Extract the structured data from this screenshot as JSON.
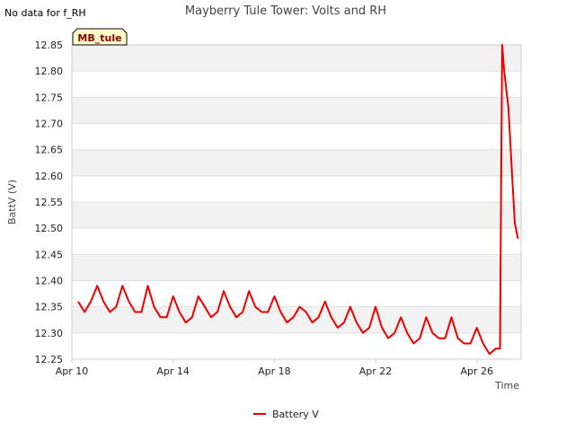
{
  "notice": "No data for f_RH",
  "badge": "MB_tule",
  "chart_data": {
    "type": "line",
    "title": "Mayberry Tule Tower: Volts and RH",
    "xlabel": "Time",
    "ylabel": "BattV (V)",
    "ylim": [
      12.25,
      12.85
    ],
    "xlim": [
      "2023-04-10",
      "2023-04-27T18:00"
    ],
    "x_ticks": [
      "Apr 10",
      "Apr 14",
      "Apr 18",
      "Apr 22",
      "Apr 26"
    ],
    "y_ticks": [
      "12.25",
      "12.30",
      "12.35",
      "12.40",
      "12.45",
      "12.50",
      "12.55",
      "12.60",
      "12.65",
      "12.70",
      "12.75",
      "12.80",
      "12.85"
    ],
    "grid": true,
    "legend": "bottom-center",
    "series": [
      {
        "name": "Battery V",
        "color": "#ee0000",
        "x": [
          "2023-04-10T06:00",
          "2023-04-10T12:00",
          "2023-04-10T18:00",
          "2023-04-11T00:00",
          "2023-04-11T06:00",
          "2023-04-11T12:00",
          "2023-04-11T18:00",
          "2023-04-12T00:00",
          "2023-04-12T06:00",
          "2023-04-12T12:00",
          "2023-04-12T18:00",
          "2023-04-13T00:00",
          "2023-04-13T06:00",
          "2023-04-13T12:00",
          "2023-04-13T18:00",
          "2023-04-14T00:00",
          "2023-04-14T06:00",
          "2023-04-14T12:00",
          "2023-04-14T18:00",
          "2023-04-15T00:00",
          "2023-04-15T06:00",
          "2023-04-15T12:00",
          "2023-04-15T18:00",
          "2023-04-16T00:00",
          "2023-04-16T06:00",
          "2023-04-16T12:00",
          "2023-04-16T18:00",
          "2023-04-17T00:00",
          "2023-04-17T06:00",
          "2023-04-17T12:00",
          "2023-04-17T18:00",
          "2023-04-18T00:00",
          "2023-04-18T06:00",
          "2023-04-18T12:00",
          "2023-04-18T18:00",
          "2023-04-19T00:00",
          "2023-04-19T06:00",
          "2023-04-19T12:00",
          "2023-04-19T18:00",
          "2023-04-20T00:00",
          "2023-04-20T06:00",
          "2023-04-20T12:00",
          "2023-04-20T18:00",
          "2023-04-21T00:00",
          "2023-04-21T06:00",
          "2023-04-21T12:00",
          "2023-04-21T18:00",
          "2023-04-22T00:00",
          "2023-04-22T06:00",
          "2023-04-22T12:00",
          "2023-04-22T18:00",
          "2023-04-23T00:00",
          "2023-04-23T06:00",
          "2023-04-23T12:00",
          "2023-04-23T18:00",
          "2023-04-24T00:00",
          "2023-04-24T06:00",
          "2023-04-24T12:00",
          "2023-04-24T18:00",
          "2023-04-25T00:00",
          "2023-04-25T06:00",
          "2023-04-25T12:00",
          "2023-04-25T18:00",
          "2023-04-26T00:00",
          "2023-04-26T06:00",
          "2023-04-26T12:00",
          "2023-04-26T18:00",
          "2023-04-26T22:00",
          "2023-04-27T00:00",
          "2023-04-27T02:00",
          "2023-04-27T06:00",
          "2023-04-27T09:00",
          "2023-04-27T12:00",
          "2023-04-27T15:00"
        ],
        "y": [
          12.36,
          12.34,
          12.36,
          12.39,
          12.36,
          12.34,
          12.35,
          12.39,
          12.36,
          12.34,
          12.34,
          12.39,
          12.35,
          12.33,
          12.33,
          12.37,
          12.34,
          12.32,
          12.33,
          12.37,
          12.35,
          12.33,
          12.34,
          12.38,
          12.35,
          12.33,
          12.34,
          12.38,
          12.35,
          12.34,
          12.34,
          12.37,
          12.34,
          12.32,
          12.33,
          12.35,
          12.34,
          12.32,
          12.33,
          12.36,
          12.33,
          12.31,
          12.32,
          12.35,
          12.32,
          12.3,
          12.31,
          12.35,
          12.31,
          12.29,
          12.3,
          12.33,
          12.3,
          12.28,
          12.29,
          12.33,
          12.3,
          12.29,
          12.29,
          12.33,
          12.29,
          12.28,
          12.28,
          12.31,
          12.28,
          12.26,
          12.27,
          12.27,
          12.85,
          12.8,
          12.73,
          12.62,
          12.51,
          12.48
        ]
      }
    ]
  }
}
